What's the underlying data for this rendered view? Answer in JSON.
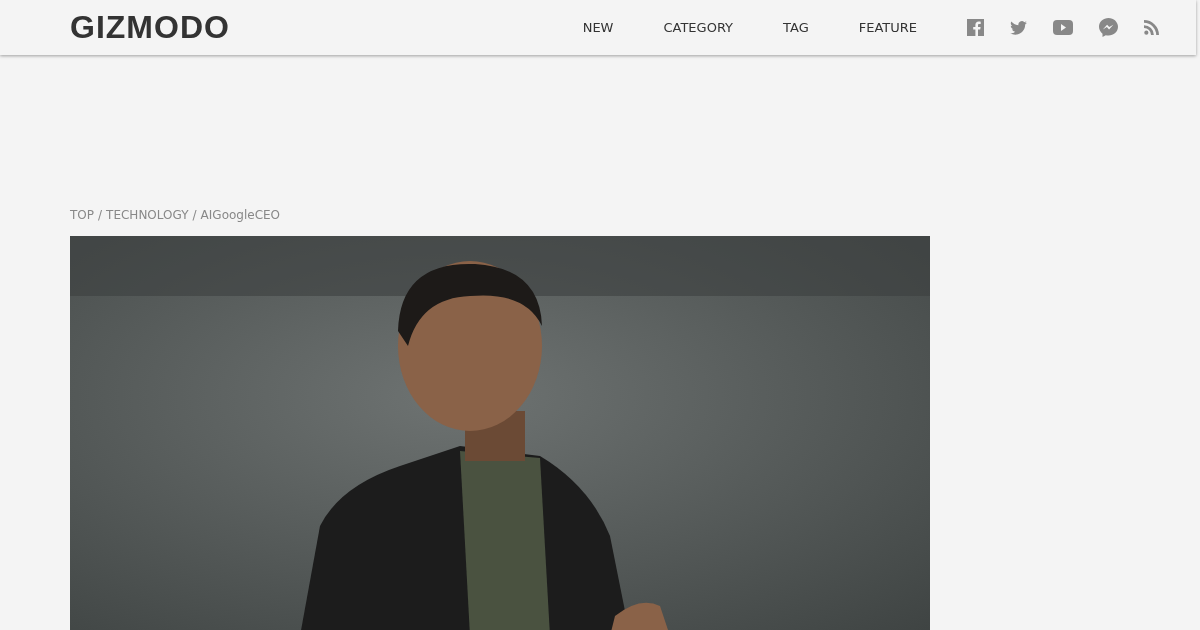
{
  "header": {
    "logo": "GIZMODO",
    "nav": [
      {
        "label": "NEW"
      },
      {
        "label": "CATEGORY"
      },
      {
        "label": "TAG"
      },
      {
        "label": "FEATURE"
      }
    ],
    "social": [
      {
        "kind": "facebook"
      },
      {
        "kind": "twitter"
      },
      {
        "kind": "youtube"
      },
      {
        "kind": "messenger"
      },
      {
        "kind": "rss"
      }
    ]
  },
  "breadcrumb": {
    "separator": "/",
    "items": [
      "TOP",
      "TECHNOLOGY",
      "AIGoogleCEO"
    ]
  }
}
